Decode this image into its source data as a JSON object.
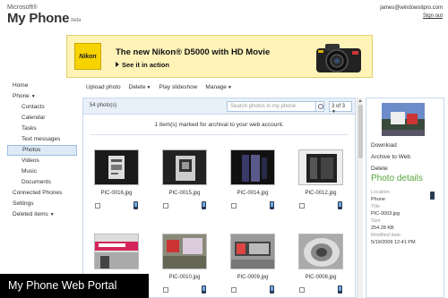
{
  "header": {
    "brand_small": "Microsoft®",
    "brand": "My Phone",
    "beta": "beta",
    "email": "james@windowsitpro.com",
    "signout": "Sign out"
  },
  "ad": {
    "logo": "Nikon",
    "headline": "The new Nikon® D5000 with HD Movie",
    "cta": "See it in action"
  },
  "nav": {
    "home": "Home",
    "phone": "Phone",
    "contacts": "Contacts",
    "calendar": "Calendar",
    "tasks": "Tasks",
    "text_messages": "Text messages",
    "photos": "Photos",
    "videos": "Videos",
    "music": "Music",
    "documents": "Documents",
    "connected_phones": "Connected Phones",
    "settings": "Settings",
    "deleted_items": "Deleted items"
  },
  "toolbar": {
    "upload": "Upload photo",
    "delete": "Delete",
    "slideshow": "Play slideshow",
    "manage": "Manage"
  },
  "gallery": {
    "count": "54 photo(s)",
    "search_placeholder": "Search photos in my phone",
    "pager": "3 of 3",
    "archive_message": "1 item(s) marked for archival to your web account.",
    "photos": [
      {
        "name": "PIC-0016.jpg"
      },
      {
        "name": "PIC-0015.jpg"
      },
      {
        "name": "PIC-0014.jpg"
      },
      {
        "name": "PIC-0012.jpg"
      },
      {
        "name": ""
      },
      {
        "name": "PIC-0010.jpg"
      },
      {
        "name": "PIC-0009.jpg"
      },
      {
        "name": "PIC-0008.jpg"
      }
    ]
  },
  "details": {
    "download": "Download",
    "archive": "Archive to Web",
    "delete": "Delete",
    "title": "Photo details",
    "location_label": "Location",
    "location_value": "Phone",
    "title_label": "Title",
    "title_value": "PIC-0003.jpg",
    "size_label": "Size",
    "size_value": "254.28 KB",
    "modified_label": "Modified date",
    "modified_value": "5/19/2009 12:41 PM"
  },
  "caption": "My Phone Web Portal",
  "colors": {
    "accent_green": "#59a53f",
    "panel_blue": "#e8f0f9",
    "ad_yellow": "#fff3b8"
  }
}
